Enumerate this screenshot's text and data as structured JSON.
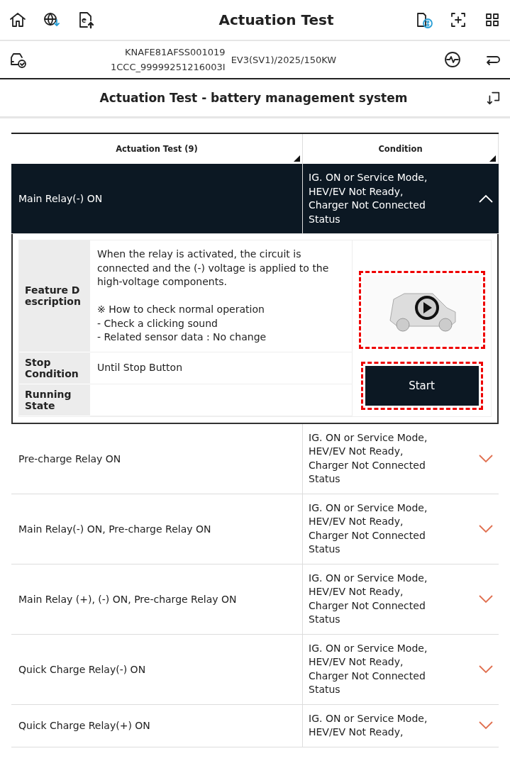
{
  "toolbar": {
    "title": "Actuation Test"
  },
  "vehicle": {
    "vin": "KNAFE81AFSS001019",
    "code": "1CCC_99999251216003I",
    "model": "EV3(SV1)/2025/150KW"
  },
  "page_title": "Actuation Test  - battery management system",
  "table": {
    "columns": [
      {
        "label": "Actuation Test (9)"
      },
      {
        "label": "Condition"
      }
    ],
    "rows": [
      {
        "name": "Main Relay(-) ON",
        "condition": "IG. ON or Service Mode,\nHEV/EV Not Ready,\nCharger Not Connected\nStatus",
        "expanded": true
      },
      {
        "name": "Pre-charge Relay ON",
        "condition": "IG. ON or Service Mode,\nHEV/EV Not Ready,\nCharger Not Connected\nStatus",
        "expanded": false
      },
      {
        "name": "Main Relay(-) ON, Pre-charge Relay ON",
        "condition": "IG. ON or Service Mode,\nHEV/EV Not Ready,\nCharger Not Connected\nStatus",
        "expanded": false
      },
      {
        "name": "Main Relay (+), (-) ON, Pre-charge Relay ON",
        "condition": "IG. ON or Service Mode,\nHEV/EV Not Ready,\nCharger Not Connected\nStatus",
        "expanded": false
      },
      {
        "name": "Quick Charge Relay(-) ON",
        "condition": "IG. ON or Service Mode,\nHEV/EV Not Ready,\nCharger Not Connected\nStatus",
        "expanded": false
      },
      {
        "name": "Quick Charge Relay(+) ON",
        "condition": "IG. ON or Service Mode,\nHEV/EV Not Ready,",
        "expanded": false
      }
    ]
  },
  "detail": {
    "fields": [
      {
        "label": "Feature D\nescription",
        "value": "When the relay is activated, the circuit is connected and the (-) voltage is applied to the high-voltage components.\n\n※ How to check normal operation\n - Check a clicking sound\n - Related sensor data : No change"
      },
      {
        "label": "Stop\nCondition",
        "value": "Until Stop Button"
      },
      {
        "label": "Running\nState"
      }
    ],
    "button": "Start"
  }
}
